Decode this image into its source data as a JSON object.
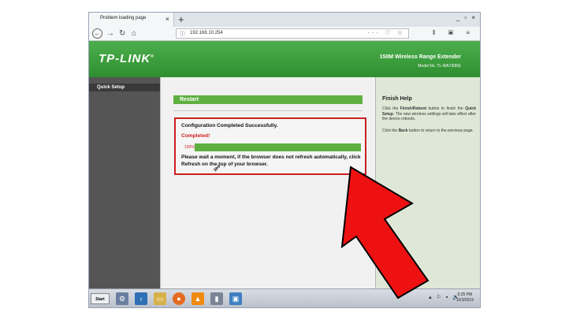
{
  "browser": {
    "tab_title": "Problem loading page",
    "tab_close": "×",
    "new_tab": "+",
    "window_controls": "_ ▫ ×",
    "url": "192.168.10.254",
    "url_icons": "··· ♡ ☆",
    "right_tools": "⫴ ▣ ≡"
  },
  "header": {
    "logo": "TP-LINK",
    "logo_mark": "®",
    "product": "150M Wireless Range Extender",
    "model": "Model No. TL-WA730RE"
  },
  "sidebar": {
    "items": [
      {
        "label": "Quick Setup"
      }
    ]
  },
  "main": {
    "section_title": "Restart",
    "status_title": "Configuration Completed Successfully.",
    "completed": "Completed!",
    "progress_label": "100%",
    "progress_value": 1.0,
    "wait_message": "Please wait a moment, if the browser does not refresh automatically, click Refresh on the top of your browser."
  },
  "help": {
    "title": "Finish Help",
    "p1_a": "Click the ",
    "p1_b": "Finish/Reboot",
    "p1_c": " button to finish the ",
    "p1_d": "Quick Setup",
    "p1_e": ". The new wireless settings will take effect after the device reboots.",
    "p2_a": "Click the ",
    "p2_b": "Back",
    "p2_c": " button to return to the previous page."
  },
  "taskbar": {
    "start": "Start",
    "tray": "▴ ⚐ ▪ 🔊",
    "time": "5:25 PM",
    "date": "10/3/2019"
  },
  "colors": {
    "banner_green": "#3a9e3a",
    "progress_green": "#5fb040",
    "highlight_red": "#cc1f1f",
    "arrow_red": "#ee1111"
  }
}
